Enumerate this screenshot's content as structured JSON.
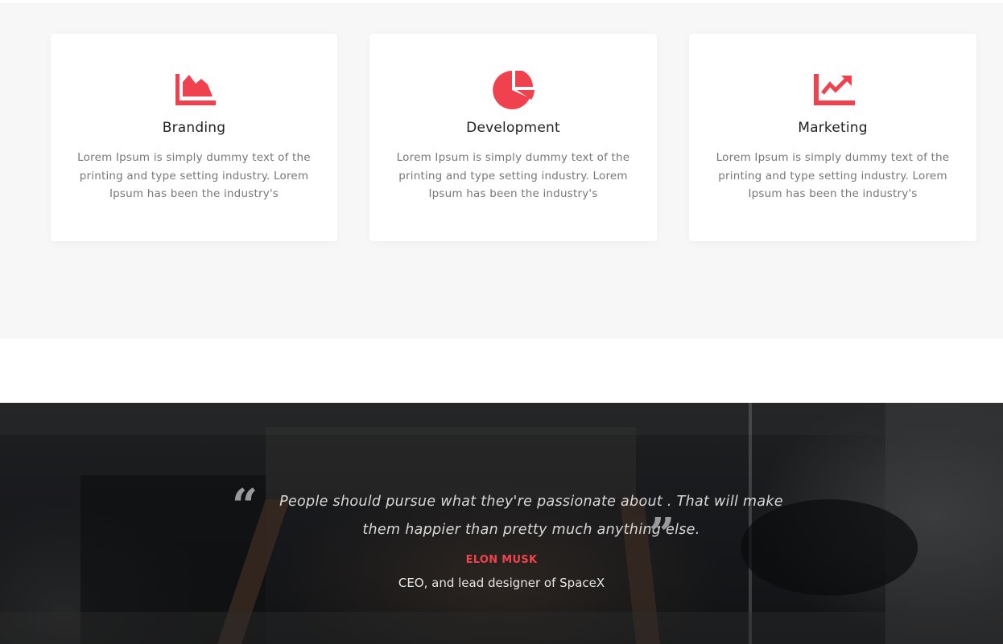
{
  "services": {
    "cards": [
      {
        "icon": "area-chart-icon",
        "title": "Branding",
        "text": "Lorem Ipsum is simply dummy text of the printing and type setting industry. Lorem Ipsum has been the industry's"
      },
      {
        "icon": "pie-chart-icon",
        "title": "Development",
        "text": "Lorem Ipsum is simply dummy text of the printing and type setting industry. Lorem Ipsum has been the industry's"
      },
      {
        "icon": "line-chart-icon",
        "title": "Marketing",
        "text": "Lorem Ipsum is simply dummy text of the printing and type setting industry. Lorem Ipsum has been the industry's"
      }
    ]
  },
  "testimonial": {
    "quote": "People should pursue what they're passionate about . That will make them happier than pretty much anything else.",
    "open_quote_glyph": "“",
    "close_quote_glyph": "”",
    "author": "ELON MUSK",
    "role": "CEO, and lead designer of SpaceX"
  },
  "colors": {
    "accent": "#f0414f",
    "section_bg": "#f7f7f8",
    "card_bg": "#ffffff",
    "dark_bg": "#16171a"
  }
}
